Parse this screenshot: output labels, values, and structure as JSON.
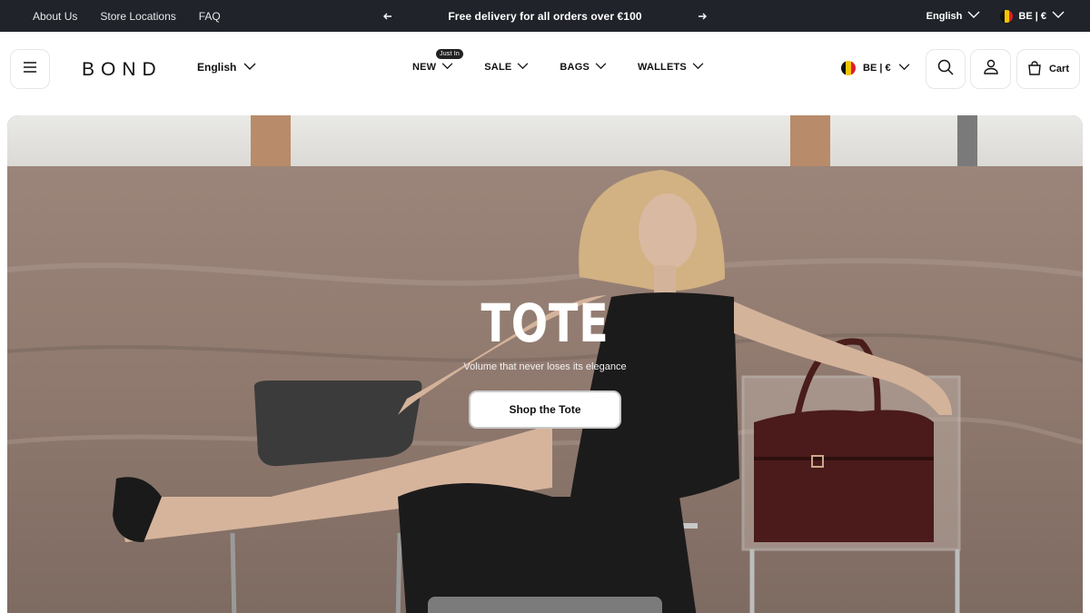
{
  "topbar": {
    "links": [
      "About Us",
      "Store Locations",
      "FAQ"
    ],
    "promo": "Free delivery for all orders over €100",
    "language": "English",
    "region": "BE | €"
  },
  "header": {
    "logo": "BOND",
    "language": "English",
    "nav": [
      {
        "label": "NEW",
        "badge": "Just In"
      },
      {
        "label": "SALE"
      },
      {
        "label": "BAGS"
      },
      {
        "label": "WALLETS"
      }
    ],
    "region": "BE | €",
    "cart_label": "Cart"
  },
  "hero": {
    "title": "TOTE",
    "subtitle": "Volume that never loses its elegance",
    "cta": "Shop the Tote"
  },
  "colors": {
    "topbar_bg": "#20232a",
    "flag_black": "#111111",
    "flag_yellow": "#f5c400",
    "flag_red": "#e11d2a"
  },
  "icons": [
    "arrow-left-icon",
    "arrow-right-icon",
    "chevron-down-icon",
    "menu-icon",
    "search-icon",
    "user-icon",
    "bag-icon",
    "belgium-flag-icon"
  ]
}
